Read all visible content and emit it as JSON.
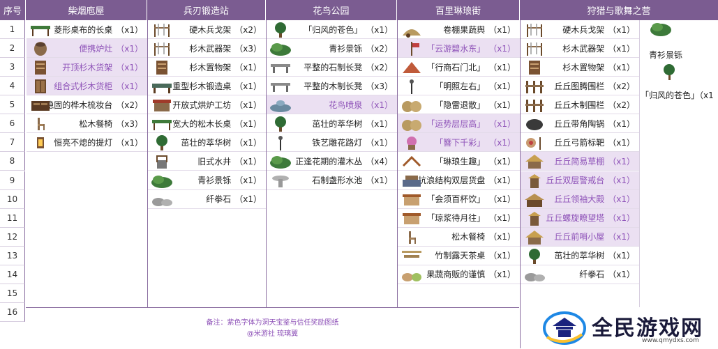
{
  "header": {
    "index_label": "序号",
    "columns": [
      "柴烟庖屋",
      "兵刃锻造站",
      "花鸟公园",
      "百里琳琅街",
      "狩猎与歌舞之营"
    ]
  },
  "row_numbers": [
    "1",
    "2",
    "3",
    "4",
    "5",
    "6",
    "7",
    "8",
    "9",
    "10",
    "11",
    "12",
    "13",
    "14",
    "15",
    "16"
  ],
  "sections": [
    {
      "items": [
        {
          "name": "菱形桌布的长桌",
          "qty": "（x1）",
          "hl": false,
          "icon": "table-icon"
        },
        {
          "name": "便携炉灶",
          "qty": "（x1）",
          "hl": true,
          "icon": "stove-icon"
        },
        {
          "name": "开顶杉木货架",
          "qty": "（x1）",
          "hl": true,
          "icon": "shelf-icon"
        },
        {
          "name": "组合式杉木货柜",
          "qty": "（x1）",
          "hl": true,
          "icon": "cabinet-icon"
        },
        {
          "name": "稳固的桦木梳妆台",
          "qty": "（x2）",
          "hl": false,
          "icon": "dresser-icon"
        },
        {
          "name": "松木餐椅",
          "qty": "（x3）",
          "hl": false,
          "icon": "chair-icon"
        },
        {
          "name": "恒亮不熄的提灯",
          "qty": "（x1）",
          "hl": false,
          "icon": "lantern-icon"
        }
      ]
    },
    {
      "items": [
        {
          "name": "硬木兵戈架",
          "qty": "（x2）",
          "hl": false,
          "icon": "weapon-rack-icon"
        },
        {
          "name": "杉木武器架",
          "qty": "（x3）",
          "hl": false,
          "icon": "weapon-rack-icon"
        },
        {
          "name": "杉木置物架",
          "qty": "（x1）",
          "hl": false,
          "icon": "shelf-icon"
        },
        {
          "name": "重型杉木锻造桌",
          "qty": "（x1）",
          "hl": false,
          "icon": "forge-table-icon"
        },
        {
          "name": "开放式烘炉工坊",
          "qty": "（x1）",
          "hl": false,
          "icon": "furnace-icon"
        },
        {
          "name": "宽大的松木长桌",
          "qty": "（x1）",
          "hl": false,
          "icon": "table-icon"
        },
        {
          "name": "茁壮的萃华树",
          "qty": "（x1）",
          "hl": false,
          "icon": "tree-icon"
        },
        {
          "name": "旧式水井",
          "qty": "（x1）",
          "hl": false,
          "icon": "well-icon"
        },
        {
          "name": "青衫景铄",
          "qty": "（x1）",
          "hl": false,
          "icon": "bush-icon"
        },
        {
          "name": "纤拳石",
          "qty": "（x1）",
          "hl": false,
          "icon": "rock-icon"
        }
      ]
    },
    {
      "items": [
        {
          "name": "「归风的苍色」",
          "qty": "（x1）",
          "hl": false,
          "icon": "tree-icon"
        },
        {
          "name": "青衫景铄",
          "qty": "（x2）",
          "hl": false,
          "icon": "bush-icon"
        },
        {
          "name": "平整的石制长凳",
          "qty": "（x2）",
          "hl": false,
          "icon": "bench-icon"
        },
        {
          "name": "平整的木制长凳",
          "qty": "（x3）",
          "hl": false,
          "icon": "bench-icon"
        },
        {
          "name": "花鸟喷泉",
          "qty": "（x1）",
          "hl": true,
          "icon": "fountain-icon"
        },
        {
          "name": "茁壮的萃华树",
          "qty": "（x1）",
          "hl": false,
          "icon": "tree-icon"
        },
        {
          "name": "铁艺雕花路灯",
          "qty": "（x1）",
          "hl": false,
          "icon": "lamp-icon"
        },
        {
          "name": "正逢花期的灌木丛",
          "qty": "（x4）",
          "hl": false,
          "icon": "bush-icon"
        },
        {
          "name": "石制盏形水池",
          "qty": "（x1）",
          "hl": false,
          "icon": "basin-icon"
        }
      ]
    },
    {
      "items": [
        {
          "name": "卷棚果蔬舆",
          "qty": "（x1）",
          "hl": false,
          "icon": "cart-icon"
        },
        {
          "name": "「云游碧水东」",
          "qty": "（x1）",
          "hl": true,
          "icon": "pole-icon"
        },
        {
          "name": "「行商石门北」",
          "qty": "（x1）",
          "hl": false,
          "icon": "tent-icon"
        },
        {
          "name": "「明照左右」",
          "qty": "（x1）",
          "hl": false,
          "icon": "lamp-icon"
        },
        {
          "name": "「隐雷退散」",
          "qty": "（x1）",
          "hl": false,
          "icon": "sack-icon"
        },
        {
          "name": "「运势层层高」",
          "qty": "（x1）",
          "hl": true,
          "icon": "sack-icon"
        },
        {
          "name": "「簪下千彩」",
          "qty": "（x1）",
          "hl": true,
          "icon": "flower-icon"
        },
        {
          "name": "「琳琅生趣」",
          "qty": "（x1）",
          "hl": false,
          "icon": "ornament-icon"
        },
        {
          "name": "抗浪结构双层货盘",
          "qty": "（x1）",
          "hl": false,
          "icon": "pallet-icon"
        },
        {
          "name": "「会须百杯饮」",
          "qty": "（x1）",
          "hl": false,
          "icon": "stall-icon"
        },
        {
          "name": "「琼浆待月往」",
          "qty": "（x1）",
          "hl": false,
          "icon": "stall-icon"
        },
        {
          "name": "松木餐椅",
          "qty": "（x1）",
          "hl": false,
          "icon": "chair-icon"
        },
        {
          "name": "竹制露天茶桌",
          "qty": "（x1）",
          "hl": false,
          "icon": "tea-table-icon"
        },
        {
          "name": "果蔬商贩的谨慎",
          "qty": "（x1）",
          "hl": false,
          "icon": "basket-icon"
        }
      ]
    },
    {
      "items": [
        {
          "name": "硬木兵戈架",
          "qty": "（x1）",
          "hl": false,
          "icon": "weapon-rack-icon"
        },
        {
          "name": "杉木武器架",
          "qty": "（x1）",
          "hl": false,
          "icon": "weapon-rack-icon"
        },
        {
          "name": "杉木置物架",
          "qty": "（x1）",
          "hl": false,
          "icon": "shelf-icon"
        },
        {
          "name": "丘丘图腾围栏",
          "qty": "（x2）",
          "hl": false,
          "icon": "fence-icon"
        },
        {
          "name": "丘丘木制围栏",
          "qty": "（x2）",
          "hl": false,
          "icon": "fence-icon"
        },
        {
          "name": "丘丘带角陶锅",
          "qty": "（x1）",
          "hl": false,
          "icon": "pot-icon"
        },
        {
          "name": "丘丘弓箭标靶",
          "qty": "（x1）",
          "hl": false,
          "icon": "target-icon"
        },
        {
          "name": "丘丘简易草棚",
          "qty": "（x1）",
          "hl": true,
          "icon": "hut-icon"
        },
        {
          "name": "丘丘双层警戒台",
          "qty": "（x1）",
          "hl": true,
          "icon": "tower-icon"
        },
        {
          "name": "丘丘领袖大殿",
          "qty": "（x1）",
          "hl": true,
          "icon": "hall-icon"
        },
        {
          "name": "丘丘螺旋瞭望塔",
          "qty": "（x1）",
          "hl": true,
          "icon": "tower-icon"
        },
        {
          "name": "丘丘前哨小屋",
          "qty": "（x1）",
          "hl": true,
          "icon": "hut-icon"
        },
        {
          "name": "茁壮的萃华树",
          "qty": "（x1）",
          "hl": false,
          "icon": "tree-icon"
        },
        {
          "name": "纤拳石",
          "qty": "（x1）",
          "hl": false,
          "icon": "rock-icon"
        }
      ]
    }
  ],
  "side_items": [
    {
      "name": "青衫景铄",
      "qty": "",
      "icon": "bush-icon"
    },
    {
      "name": "「归风的苍色」",
      "qty": "（x1",
      "icon": "tree-icon"
    }
  ],
  "note": {
    "line1": "备注：紫色字体为洞天宝鉴与信任奖励图纸",
    "line2": "@米游社  琉璃翼"
  },
  "logo": {
    "text": "全民游戏网",
    "url_text": "www.qmydxs.com"
  },
  "colors": {
    "header_bg": "#7b5c91",
    "highlight_bg": "#ebe0f2",
    "highlight_text": "#8e52b8"
  }
}
